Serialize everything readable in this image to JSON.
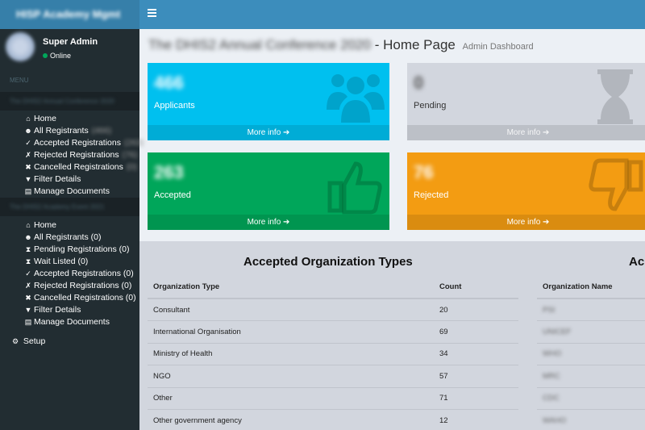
{
  "header": {
    "logo": "HISP Academy Mgmt"
  },
  "sidebar": {
    "user_name": "Super Admin",
    "user_status": "Online",
    "menu_label": "MENU",
    "group1_header": "The DHIS2 Annual Conference 2020",
    "group1_items": [
      {
        "label": "Home",
        "icon": "home-icon",
        "count": ""
      },
      {
        "label": "All Registrants",
        "icon": "users-icon",
        "count": "(466)"
      },
      {
        "label": "Accepted Registrations",
        "icon": "thumbs-up-icon",
        "count": "(263)"
      },
      {
        "label": "Rejected Registrations",
        "icon": "thumbs-down-icon",
        "count": "(76)"
      },
      {
        "label": "Cancelled Registrations",
        "icon": "times-icon",
        "count": "(0)"
      },
      {
        "label": "Filter Details",
        "icon": "filter-icon",
        "count": ""
      },
      {
        "label": "Manage Documents",
        "icon": "document-icon",
        "count": ""
      }
    ],
    "group2_header": "The DHIS2 Academy Event 2021",
    "group2_items": [
      {
        "label": "Home",
        "icon": "home-icon",
        "count": ""
      },
      {
        "label": "All Registrants (0)",
        "icon": "users-icon",
        "count": ""
      },
      {
        "label": "Pending Registrations (0)",
        "icon": "hourglass-icon",
        "count": ""
      },
      {
        "label": "Wait Listed (0)",
        "icon": "hourglass-icon",
        "count": ""
      },
      {
        "label": "Accepted Registrations (0)",
        "icon": "thumbs-up-icon",
        "count": ""
      },
      {
        "label": "Rejected Registrations (0)",
        "icon": "thumbs-down-icon",
        "count": ""
      },
      {
        "label": "Cancelled Registrations (0)",
        "icon": "times-icon",
        "count": ""
      },
      {
        "label": "Filter Details",
        "icon": "filter-icon",
        "count": ""
      },
      {
        "label": "Manage Documents",
        "icon": "document-icon",
        "count": ""
      }
    ],
    "setup_label": "Setup"
  },
  "page": {
    "title_blurred": "The DHIS2 Annual Conference 2020",
    "title": "- Home Page",
    "subtitle": "Admin Dashboard"
  },
  "boxes": [
    {
      "number": "466",
      "label": "Applicants",
      "more": "More info ➔",
      "color": "#00c0ef",
      "icon": "users-icon"
    },
    {
      "number": "0",
      "label": "Pending",
      "more": "More info ➔",
      "color": "#d2d6de",
      "icon": "hourglass-icon"
    },
    {
      "number": "263",
      "label": "Accepted",
      "more": "More info ➔",
      "color": "#00a65a",
      "icon": "thumbs-up-icon"
    },
    {
      "number": "76",
      "label": "Rejected",
      "more": "More info ➔",
      "color": "#f39c12",
      "icon": "thumbs-down-icon"
    }
  ],
  "org_types": {
    "title": "Accepted Organization Types",
    "headers": [
      "Organization Type",
      "Count"
    ],
    "rows": [
      [
        "Consultant",
        "20"
      ],
      [
        "International Organisation",
        "69"
      ],
      [
        "Ministry of Health",
        "34"
      ],
      [
        "NGO",
        "57"
      ],
      [
        "Other",
        "71"
      ],
      [
        "Other government agency",
        "12"
      ]
    ]
  },
  "org_names": {
    "title": "Ac",
    "header": "Organization Name",
    "rows": [
      "PSI",
      "UNICEF",
      "WHO",
      "MRC",
      "CDC",
      "WAHO"
    ]
  }
}
